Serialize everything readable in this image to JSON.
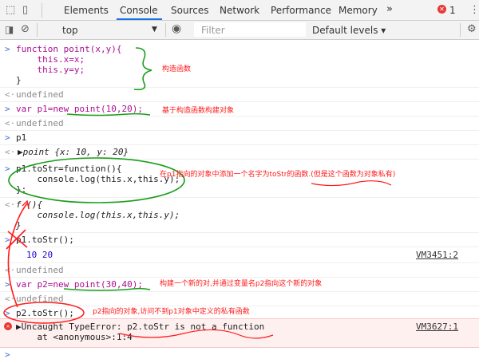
{
  "devtools": {
    "tabs": [
      "Elements",
      "Console",
      "Sources",
      "Network",
      "Performance",
      "Memory"
    ],
    "more_tabs": "»",
    "error_count": "1",
    "context": "top",
    "filter_placeholder": "Filter",
    "levels": "Default levels ▾"
  },
  "console": {
    "entries": [
      {
        "type": "input",
        "lines": [
          "function point(x,y){",
          "    this.x=x;",
          "    this.y=y;",
          "}"
        ]
      },
      {
        "type": "result",
        "text": "undefined"
      },
      {
        "type": "input",
        "text": "var p1=new point(10,20);"
      },
      {
        "type": "result",
        "text": "undefined"
      },
      {
        "type": "input",
        "text": "p1"
      },
      {
        "type": "result",
        "text": "▶point {x: 10, y: 20}"
      },
      {
        "type": "input",
        "lines": [
          "p1.toStr=function(){",
          "    console.log(this.x,this.y);",
          "};"
        ]
      },
      {
        "type": "result",
        "lines": [
          "f (){",
          "    console.log(this.x,this.y);",
          "}"
        ]
      },
      {
        "type": "input",
        "text": "p1.toStr();"
      },
      {
        "type": "log",
        "text": "10 20",
        "source": "VM3451:2"
      },
      {
        "type": "result",
        "text": "undefined"
      },
      {
        "type": "input",
        "text": "var p2=new point(30,40);"
      },
      {
        "type": "result",
        "text": "undefined"
      },
      {
        "type": "input",
        "text": "p2.toStr();"
      },
      {
        "type": "error",
        "lines": [
          "▶Uncaught TypeError: p2.toStr is not a function",
          "    at <anonymous>:1:4"
        ],
        "source": "VM3627:1"
      },
      {
        "type": "prompt",
        "text": ""
      }
    ]
  },
  "annotations": [
    "构造函数",
    "基于构造函数构建对象",
    "在p1指向的对象中添加一个名字为toStr的函数.(但是这个函数为对象私有)",
    "构建一个新的对,并通过变量名p2指向这个新的对象",
    "p2指向的对象,访问不到p1对象中定义的私有函数"
  ],
  "colors": {
    "keyword": "#aa0d91",
    "number": "#1c00cf",
    "error": "#e00000",
    "annotation": "#ff1a1a",
    "annotation_green": "#1a9e1a",
    "accent": "#1a73e8"
  }
}
